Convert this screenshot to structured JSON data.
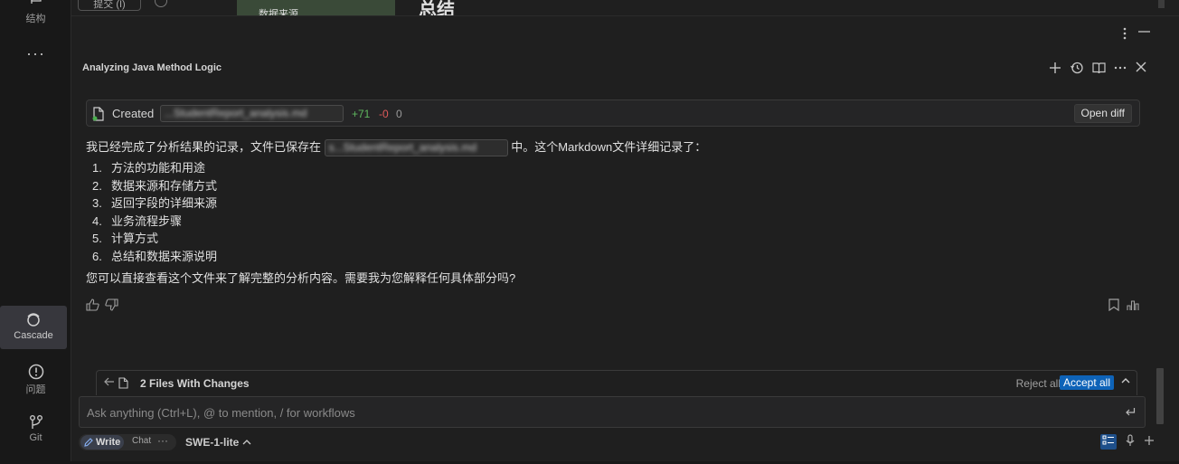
{
  "activity_bar": {
    "items": [
      {
        "label": "结构",
        "icon": "structure-icon"
      },
      {
        "label": "Cascade",
        "icon": "cascade-icon"
      },
      {
        "label": "问题",
        "icon": "problems-icon"
      },
      {
        "label": "Git",
        "icon": "git-icon"
      }
    ],
    "more": "···"
  },
  "top_strip": {
    "submit_label": "提交 (I)",
    "code_line": "数据来源",
    "heading": "总结"
  },
  "chat": {
    "title": "Analyzing Java Method Logic",
    "created": {
      "label": "Created",
      "file": "...StudentReport_analysis.md",
      "added": "+71",
      "removed": "-0",
      "unchanged": "0",
      "open_diff": "Open diff"
    },
    "message_before": "我已经完成了分析结果的记录，文件已保存在",
    "message_file": "s...StudentReport_analysis.md",
    "message_after": "中。这个Markdown文件详细记录了：",
    "steps": [
      {
        "num": "1.",
        "text": "方法的功能和用途"
      },
      {
        "num": "2.",
        "text": "数据来源和存储方式"
      },
      {
        "num": "3.",
        "text": "返回字段的详细来源"
      },
      {
        "num": "4.",
        "text": "业务流程步骤"
      },
      {
        "num": "5.",
        "text": "计算方式"
      },
      {
        "num": "6.",
        "text": "总结和数据来源说明"
      }
    ],
    "followup": "您可以直接查看这个文件来了解完整的分析内容。需要我为您解释任何具体部分吗?",
    "changes": {
      "label": "2 Files With Changes",
      "reject": "Reject all",
      "accept": "Accept all"
    },
    "input_placeholder": "Ask anything (Ctrl+L), @ to mention, / for workflows",
    "mode_write": "Write",
    "mode_chat": "Chat",
    "more": "···",
    "model": "SWE-1-lite"
  },
  "colors": {
    "accent": "#0e63b8",
    "added": "#5fb85f",
    "removed": "#e05a5a"
  }
}
